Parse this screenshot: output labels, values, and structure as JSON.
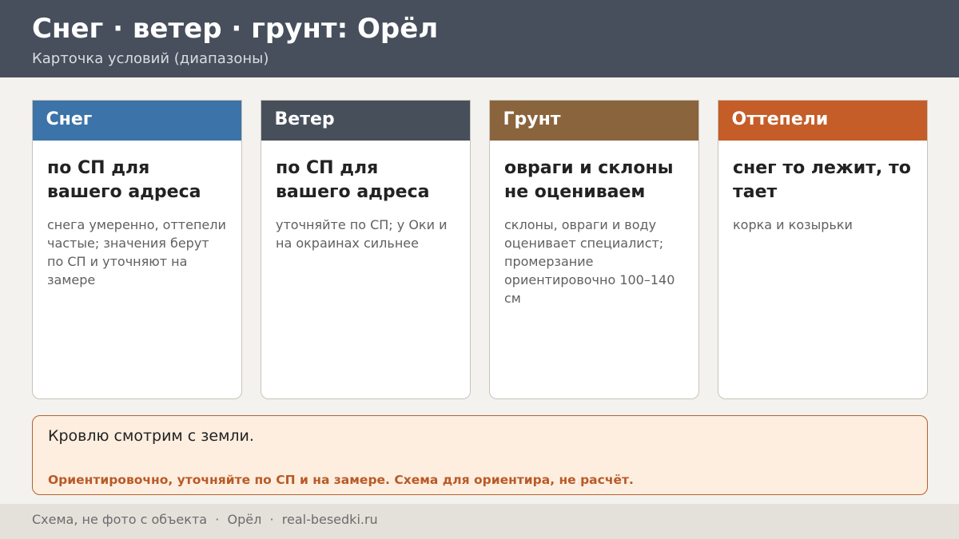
{
  "header": {
    "title": "Снег · ветер · грунт: Орёл",
    "subtitle": "Карточка условий (диапазоны)"
  },
  "cards": [
    {
      "label": "Снег",
      "main": "по СП для вашего адреса",
      "note": "снега умеренно, оттепели частые; значения берут по СП и уточняют на замере",
      "color": "#3c73a8"
    },
    {
      "label": "Ветер",
      "main": "по СП для вашего адреса",
      "note": "уточняйте по СП; у Оки и на окраинах сильнее",
      "color": "#474f5b"
    },
    {
      "label": "Грунт",
      "main": "овраги и склоны не оцениваем",
      "note": "склоны, овраги и воду оценивает специалист; промерзание ориентировочно 100–140 см",
      "color": "#8a643d"
    },
    {
      "label": "Оттепели",
      "main": "снег то лежит, то тает",
      "note": "корка и козырьки",
      "color": "#c45d27"
    }
  ],
  "note_box": {
    "main": "Кровлю смотрим с земли.",
    "warning": "Ориентировочно, уточняйте по СП и на замере. Схема для ориентира, не расчёт."
  },
  "footer": {
    "text": "Схема, не фото с объекта  ·  Орёл  ·  real-besedki.ru"
  }
}
